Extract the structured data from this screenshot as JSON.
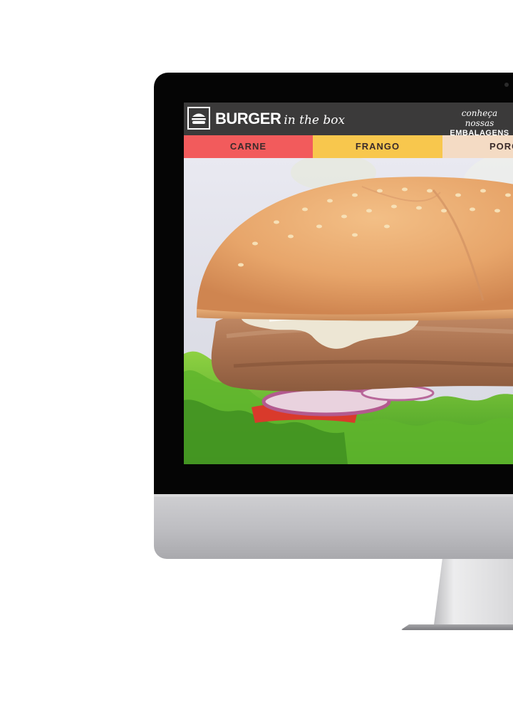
{
  "site": {
    "brand_main": "BURGER",
    "brand_sub": "in the box",
    "cta_line1": "conheça nossas",
    "cta_line2": "EMBALAGENS"
  },
  "categories": [
    {
      "label": "CARNE",
      "color": "#f25b5c"
    },
    {
      "label": "FRANGO",
      "color": "#f8c74d"
    },
    {
      "label": "PORC",
      "color": "#f4dbc4"
    }
  ],
  "colors": {
    "header_bg": "#3b3a3a",
    "bezel": "#050505",
    "chin": "#bdbdc1"
  },
  "icons": {
    "logo": "burger-icon"
  }
}
